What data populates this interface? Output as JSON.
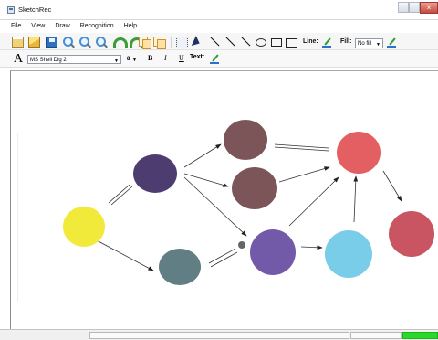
{
  "window": {
    "title": "SketchRec"
  },
  "menu": {
    "items": [
      "File",
      "View",
      "Draw",
      "Recognition",
      "Help"
    ]
  },
  "toolbar": {
    "line_label": "Line:",
    "fill_label": "Fill:",
    "fill_value": "No fill",
    "font_value": "MS Shell Dlg 2",
    "font_size": "8",
    "bold_label": "B",
    "italic_label": "I",
    "underline_label": "U",
    "text_label": "Text:"
  },
  "status": {
    "left_text": "",
    "progress": 1
  },
  "colors": {
    "yellow": "#f2ea3b",
    "indigo": "#4d3c6f",
    "brown_top": "#7c5559",
    "brown_mid": "#7c5559",
    "teal": "#607e83",
    "purple": "#735aa9",
    "red": "#e45f62",
    "cyan": "#79cde8",
    "crimson": "#c95462"
  },
  "icons": [
    "app-icon",
    "new-file-icon",
    "open-folder-icon",
    "save-icon",
    "zoom-in-icon",
    "zoom-out-icon",
    "zoom-fit-icon",
    "rotate-left-icon",
    "rotate-right-icon",
    "copy-icon",
    "paste-icon",
    "select-rect-icon",
    "pointer-icon",
    "line-icon",
    "arrow-line-icon",
    "ellipse-icon",
    "rectangle-icon",
    "text-box-icon",
    "line-color-icon",
    "fill-color-icon",
    "font-icon",
    "text-color-icon"
  ]
}
